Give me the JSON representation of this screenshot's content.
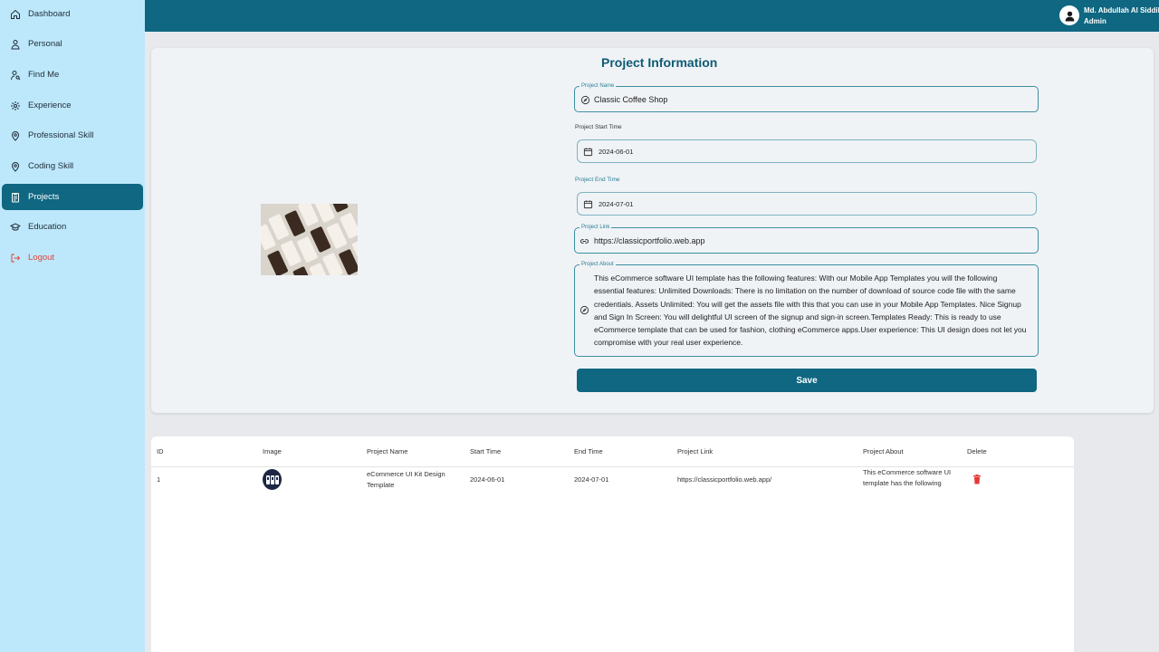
{
  "sidebar": {
    "items": [
      {
        "label": "Dashboard",
        "icon": "home-icon"
      },
      {
        "label": "Personal",
        "icon": "person-icon"
      },
      {
        "label": "Find Me",
        "icon": "find-me-icon"
      },
      {
        "label": "Experience",
        "icon": "experience-icon"
      },
      {
        "label": "Professional Skill",
        "icon": "location-pin-icon"
      },
      {
        "label": "Coding Skill",
        "icon": "location-pin-icon"
      },
      {
        "label": "Projects",
        "icon": "clipboard-icon",
        "active": true
      },
      {
        "label": "Education",
        "icon": "graduation-cap-icon"
      },
      {
        "label": "Logout",
        "icon": "logout-icon"
      }
    ]
  },
  "user": {
    "name": "Md. Abdullah Al Siddik",
    "role": "Admin"
  },
  "form": {
    "title": "Project Information",
    "project_name_label": "Project Name",
    "project_name_value": "Classic Coffee Shop",
    "start_label": "Project Start Time",
    "start_value": "2024-06-01",
    "end_label": "Project End Time",
    "end_value": "2024-07-01",
    "link_label": "Project Link",
    "link_value": "https://classicportfolio.web.app",
    "about_label": "Project About",
    "about_value": " This eCommerce software UI template has the following features: With our Mobile App Templates you will the following essential features: Unlimited Downloads: There is no limitation on the number of download of source code file with the same credentials. Assets Unlimited: You will get the assets file with this that you can use in your Mobile App Templates. Nice Signup and Sign In Screen: You will delightful UI screen of the signup and sign-in screen.Templates Ready: This is ready to use eCommerce template that can be used for fashion, clothing eCommerce apps.User experience: This UI design does not let you compromise with your real user experience.",
    "save_label": "Save"
  },
  "table": {
    "headers": [
      "ID",
      "Image",
      "Project Name",
      "Start Time",
      "End Time",
      "Project Link",
      "Project About",
      "Delete"
    ],
    "rows": [
      {
        "id": "1",
        "name": "eCommerce UI Kit Design Template",
        "start": "2024-06-01",
        "end": "2024-07-01",
        "link": "https://classicportfolio.web.app/",
        "about": " This eCommerce software UI template has the following features: With our Mobile App Templates"
      }
    ]
  },
  "colors": {
    "primary": "#0f6781",
    "sidebar_bg": "#bde8fb",
    "logout": "#e0443a",
    "delete": "#e53935"
  }
}
